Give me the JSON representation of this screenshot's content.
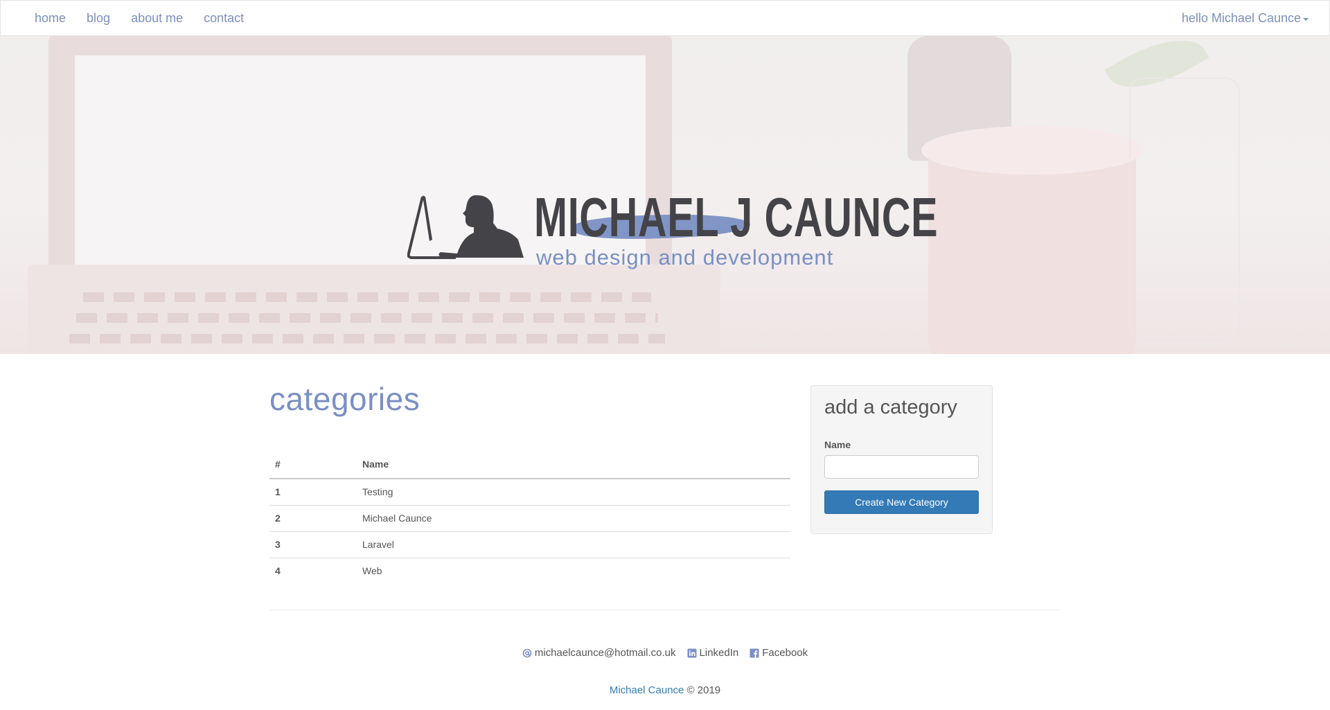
{
  "nav": {
    "links": [
      "home",
      "blog",
      "about me",
      "contact"
    ],
    "user_menu": "hello Michael Caunce"
  },
  "hero": {
    "logo_title": "MICHAEL J CAUNCE",
    "logo_tagline": "web design and development"
  },
  "main": {
    "title": "categories",
    "table": {
      "headers": [
        "#",
        "Name"
      ],
      "rows": [
        {
          "id": "1",
          "name": "Testing"
        },
        {
          "id": "2",
          "name": "Michael Caunce"
        },
        {
          "id": "3",
          "name": "Laravel"
        },
        {
          "id": "4",
          "name": "Web"
        }
      ]
    }
  },
  "panel": {
    "title": "add a category",
    "label": "Name",
    "input_value": "",
    "button": "Create New Category"
  },
  "footer": {
    "email": "michaelcaunce@hotmail.co.uk",
    "linkedin": "LinkedIn",
    "facebook": "Facebook",
    "copyright_owner": "Michael Caunce",
    "copyright_text": "© 2019"
  },
  "colors": {
    "accent": "#7a8fc4",
    "button": "#337ab7"
  },
  "icons": [
    "at-icon",
    "linkedin-icon",
    "facebook-icon",
    "caret-down-icon"
  ]
}
